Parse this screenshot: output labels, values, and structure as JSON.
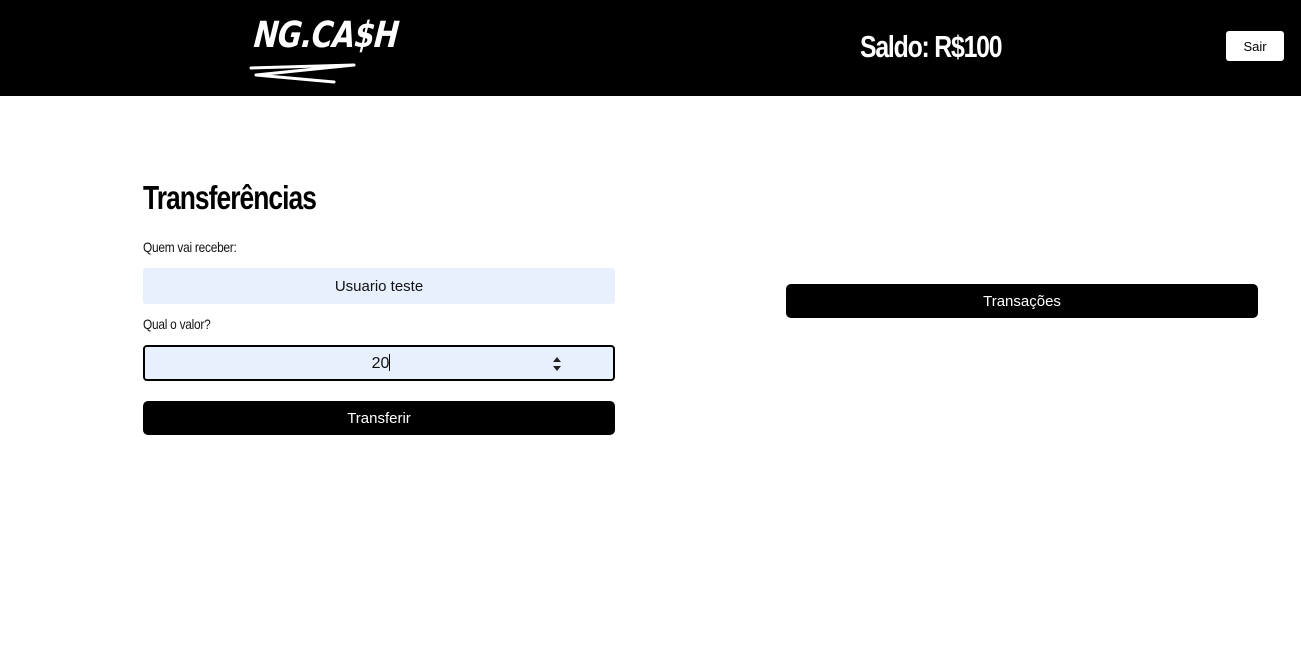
{
  "header": {
    "logo_text": "NG.CA$H",
    "balance_label": "Saldo: R$100",
    "logout_label": "Sair"
  },
  "transfer": {
    "title": "Transferências",
    "recipient_label": "Quem vai receber:",
    "recipient_value": "Usuario teste",
    "amount_label": "Qual o valor?",
    "amount_value": "20",
    "submit_label": "Transferir"
  },
  "transactions": {
    "button_label": "Transações"
  }
}
